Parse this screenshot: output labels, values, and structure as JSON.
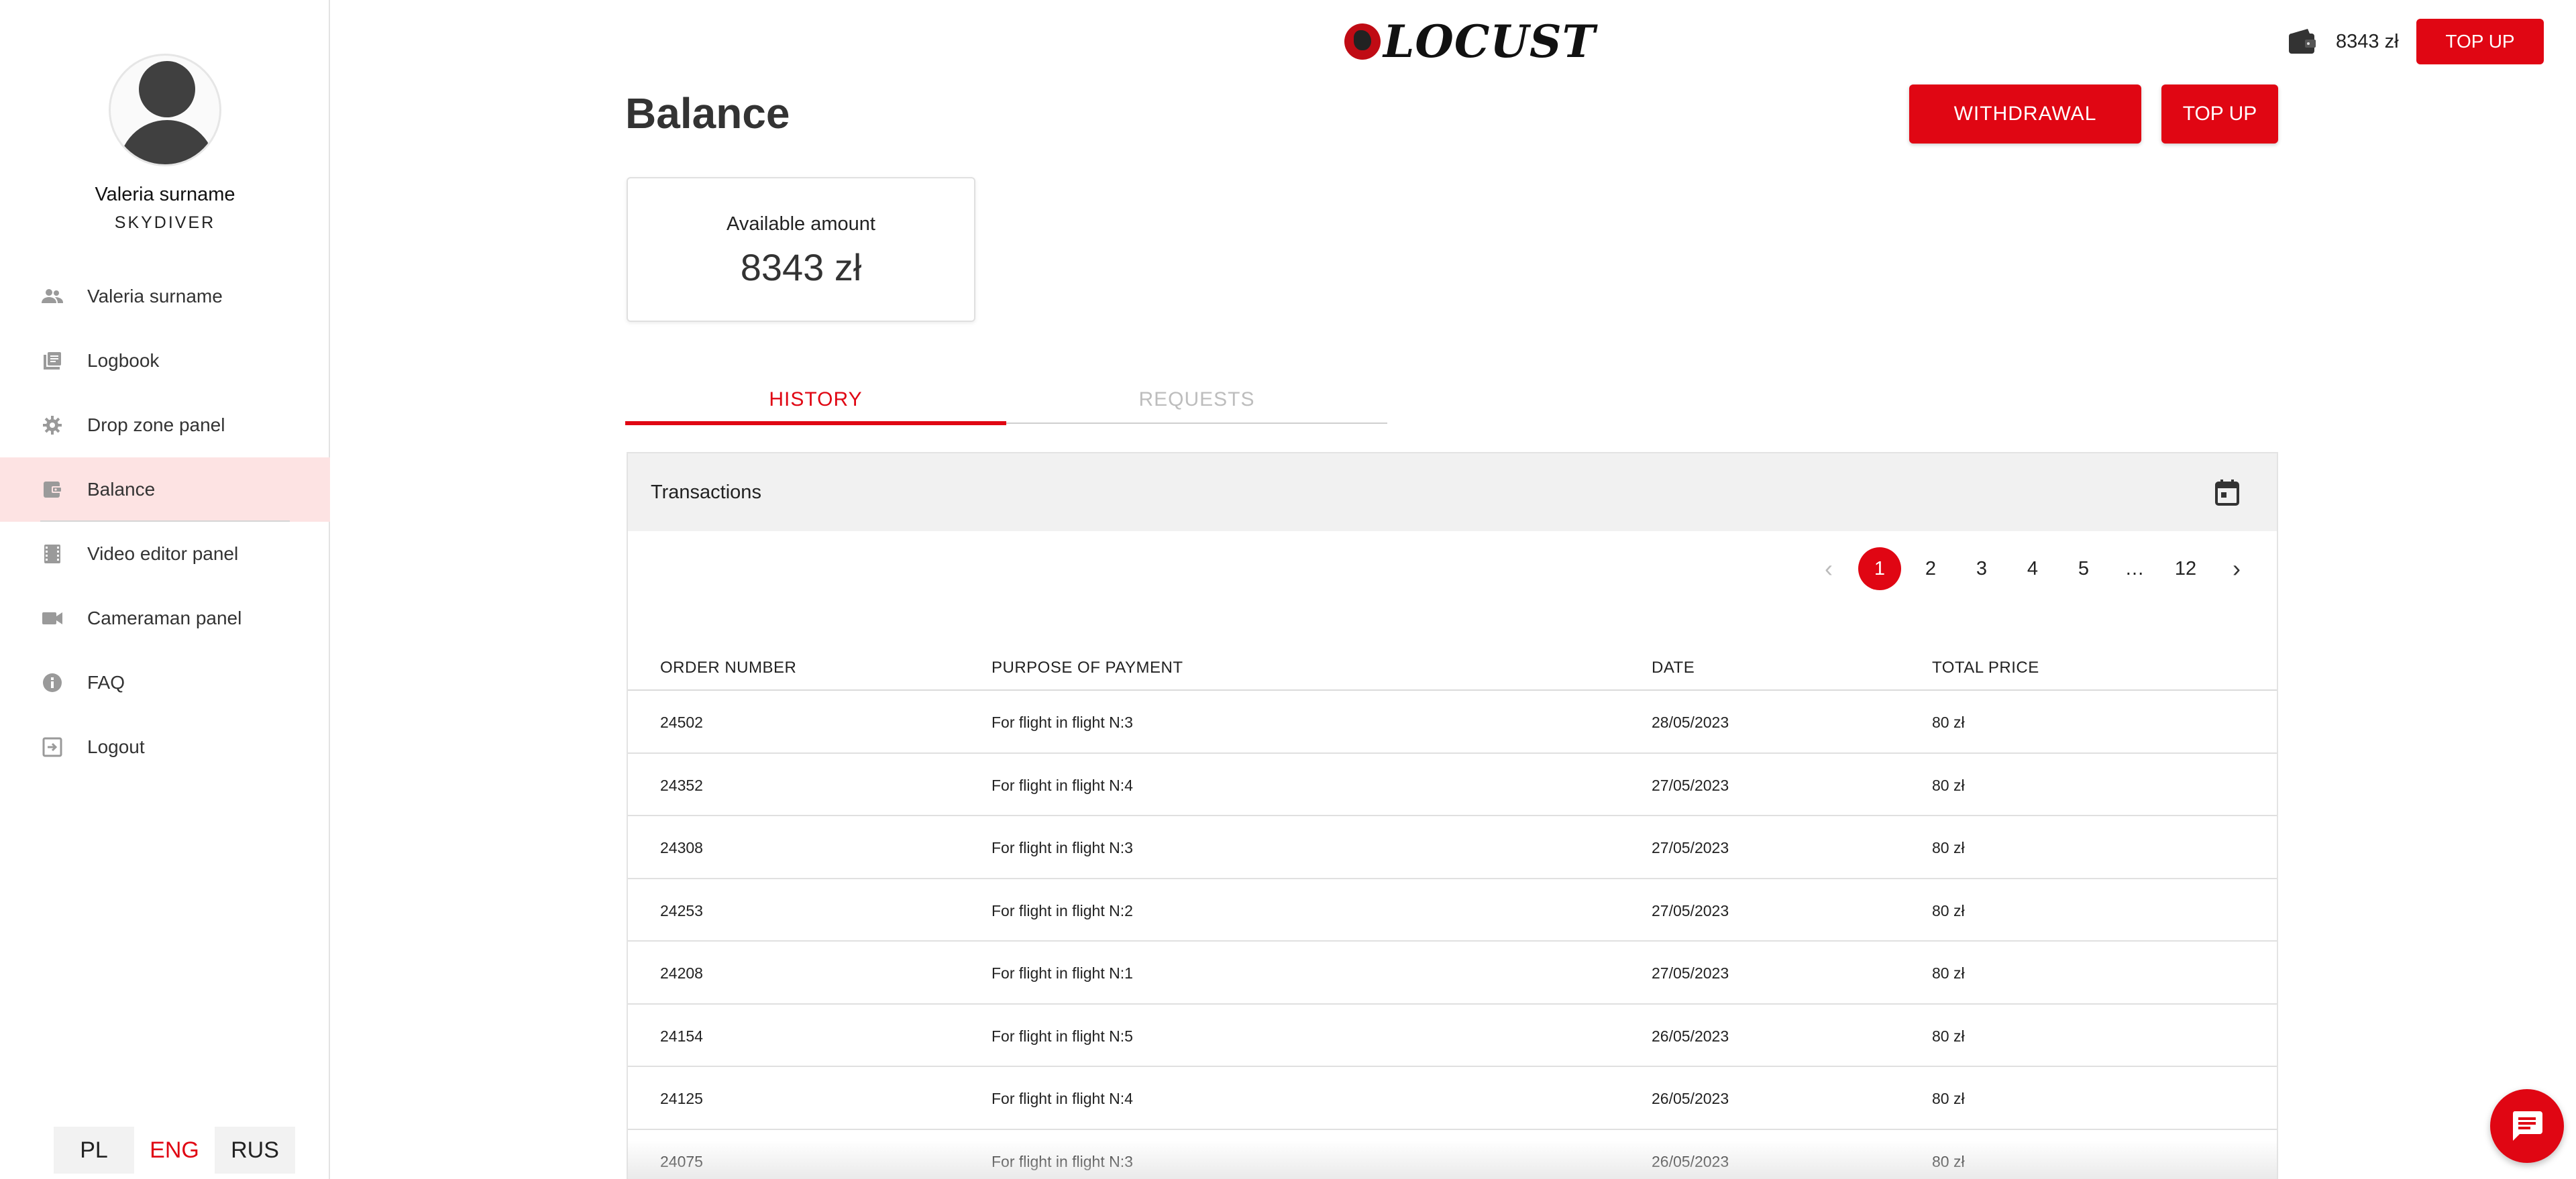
{
  "user": {
    "name": "Valeria surname",
    "role": "SKYDIVER"
  },
  "nav": {
    "items": [
      {
        "label": "Valeria surname",
        "icon": "people-icon"
      },
      {
        "label": "Logbook",
        "icon": "book-icon"
      },
      {
        "label": "Drop zone panel",
        "icon": "gear-icon"
      },
      {
        "label": "Balance",
        "icon": "wallet-icon",
        "active": true
      },
      {
        "label": "Video editor panel",
        "icon": "film-icon"
      },
      {
        "label": "Cameraman panel",
        "icon": "videocam-icon"
      },
      {
        "label": "FAQ",
        "icon": "info-icon"
      },
      {
        "label": "Logout",
        "icon": "logout-icon"
      }
    ]
  },
  "languages": {
    "pl": "PL",
    "eng": "ENG",
    "rus": "RUS",
    "active": "ENG"
  },
  "header": {
    "logo_text": "LOCUST",
    "balance": "8343 zł",
    "topup_label": "TOP UP"
  },
  "page": {
    "title": "Balance",
    "withdrawal_label": "WITHDRAWAL",
    "topup_label": "TOP UP",
    "available_label": "Available amount",
    "available_amount": "8343 zł"
  },
  "tabs": {
    "history": "HISTORY",
    "requests": "REQUESTS",
    "active": "HISTORY"
  },
  "transactions": {
    "title": "Transactions",
    "pagination": {
      "pages": [
        "1",
        "2",
        "3",
        "4",
        "5",
        "…",
        "12"
      ],
      "current": "1"
    },
    "columns": [
      "ORDER NUMBER",
      "PURPOSE OF PAYMENT",
      "DATE",
      "TOTAL PRICE"
    ],
    "rows": [
      {
        "order": "24502",
        "purpose": "For flight in flight N:3",
        "date": "28/05/2023",
        "price": "80 zł"
      },
      {
        "order": "24352",
        "purpose": "For flight in flight N:4",
        "date": "27/05/2023",
        "price": "80 zł"
      },
      {
        "order": "24308",
        "purpose": "For flight in flight N:3",
        "date": "27/05/2023",
        "price": "80 zł"
      },
      {
        "order": "24253",
        "purpose": "For flight in flight N:2",
        "date": "27/05/2023",
        "price": "80 zł"
      },
      {
        "order": "24208",
        "purpose": "For flight in flight N:1",
        "date": "27/05/2023",
        "price": "80 zł"
      },
      {
        "order": "24154",
        "purpose": "For flight in flight N:5",
        "date": "26/05/2023",
        "price": "80 zł"
      },
      {
        "order": "24125",
        "purpose": "For flight in flight N:4",
        "date": "26/05/2023",
        "price": "80 zł"
      },
      {
        "order": "24075",
        "purpose": "For flight in flight N:3",
        "date": "26/05/2023",
        "price": "80 zł"
      }
    ]
  },
  "colors": {
    "accent": "#e00613",
    "active_nav_bg": "#fde3e3"
  }
}
